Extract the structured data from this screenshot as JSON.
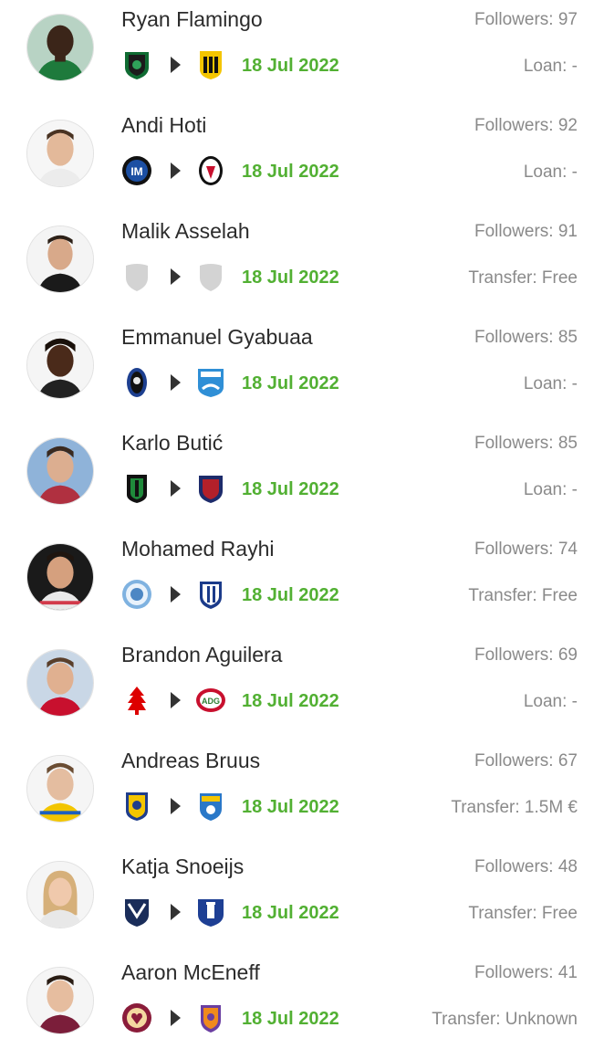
{
  "colors": {
    "date_green": "#52b033",
    "muted_text": "#8a8a8a",
    "name_text": "#2b2b2b",
    "arrow": "#333333"
  },
  "transfers": [
    {
      "name": "Ryan Flamingo",
      "followers": "Followers: 97",
      "date": "18 Jul 2022",
      "transfer": "Loan: -",
      "from_icon": "sassuolo-crest-icon",
      "to_icon": "vitesse-crest-icon",
      "avatar_icon": "player-photo-icon"
    },
    {
      "name": "Andi Hoti",
      "followers": "Followers: 92",
      "date": "18 Jul 2022",
      "transfer": "Loan: -",
      "from_icon": "inter-crest-icon",
      "to_icon": "freiburg-crest-icon",
      "avatar_icon": "player-photo-icon"
    },
    {
      "name": "Malik Asselah",
      "followers": "Followers: 91",
      "date": "18 Jul 2022",
      "transfer": "Transfer: Free",
      "from_icon": "unknown-club-shield-icon",
      "to_icon": "unknown-club-shield-icon",
      "avatar_icon": "player-photo-icon"
    },
    {
      "name": "Emmanuel Gyabuaa",
      "followers": "Followers: 85",
      "date": "18 Jul 2022",
      "transfer": "Loan: -",
      "from_icon": "atalanta-crest-icon",
      "to_icon": "pescara-crest-icon",
      "avatar_icon": "player-photo-icon"
    },
    {
      "name": "Karlo Butić",
      "followers": "Followers: 85",
      "date": "18 Jul 2022",
      "transfer": "Loan: -",
      "from_icon": "pordenone-crest-icon",
      "to_icon": "crest-icon",
      "avatar_icon": "player-photo-icon"
    },
    {
      "name": "Mohamed Rayhi",
      "followers": "Followers: 74",
      "date": "18 Jul 2022",
      "transfer": "Transfer: Free",
      "from_icon": "crest-icon",
      "to_icon": "crest-icon",
      "avatar_icon": "player-photo-icon"
    },
    {
      "name": "Brandon Aguilera",
      "followers": "Followers: 69",
      "date": "18 Jul 2022",
      "transfer": "Loan: -",
      "from_icon": "nottingham-forest-crest-icon",
      "to_icon": "adg-crest-icon",
      "avatar_icon": "player-photo-icon"
    },
    {
      "name": "Andreas Bruus",
      "followers": "Followers: 67",
      "date": "18 Jul 2022",
      "transfer": "Transfer: 1.5M €",
      "from_icon": "brondby-crest-icon",
      "to_icon": "estac-troyes-crest-icon",
      "avatar_icon": "player-photo-icon"
    },
    {
      "name": "Katja Snoeijs",
      "followers": "Followers: 48",
      "date": "18 Jul 2022",
      "transfer": "Transfer: Free",
      "from_icon": "bordeaux-crest-icon",
      "to_icon": "everton-crest-icon",
      "avatar_icon": "player-photo-icon"
    },
    {
      "name": "Aaron McEneff",
      "followers": "Followers: 41",
      "date": "18 Jul 2022",
      "transfer": "Transfer: Unknown",
      "from_icon": "hearts-crest-icon",
      "to_icon": "perth-glory-crest-icon",
      "avatar_icon": "player-photo-icon"
    }
  ]
}
